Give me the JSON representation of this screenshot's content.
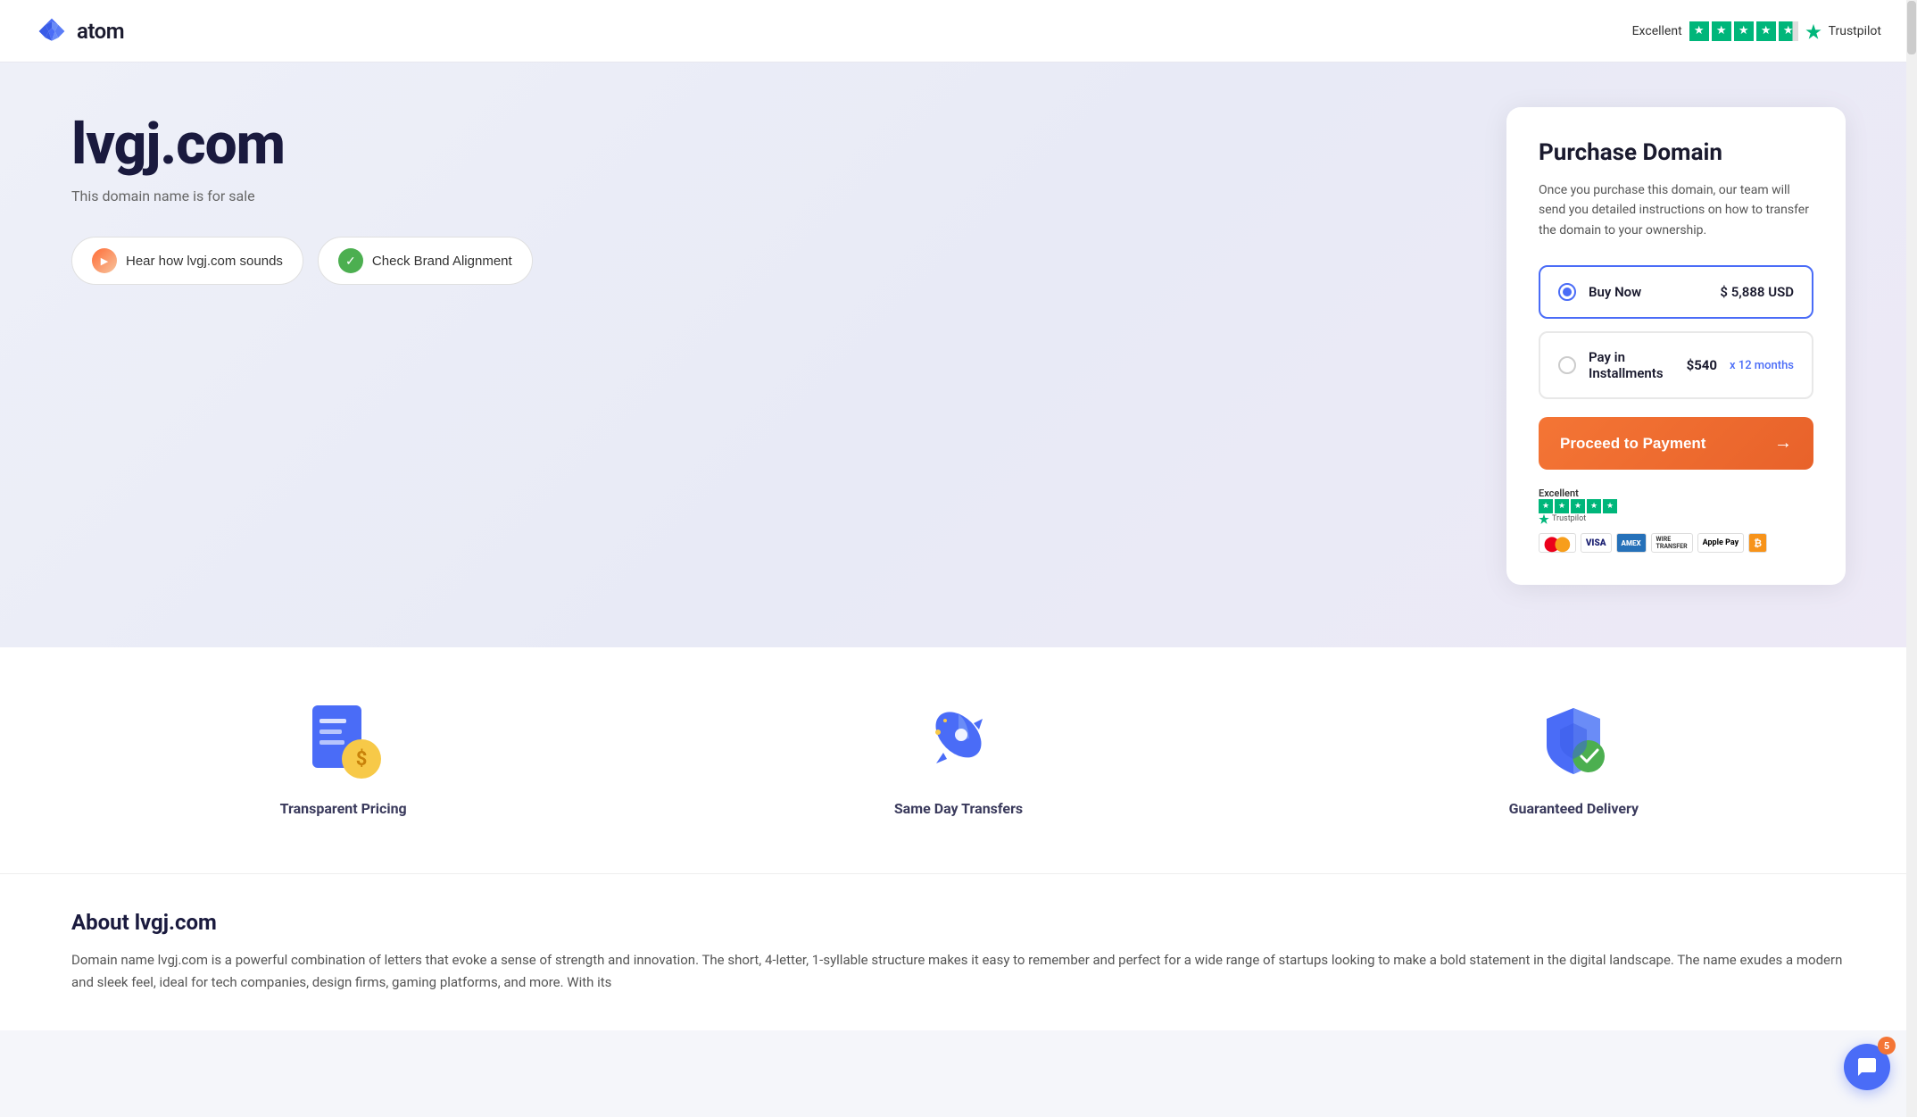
{
  "header": {
    "logo_text": "atom",
    "trustpilot_label": "Excellent",
    "trustpilot_brand": "Trustpilot"
  },
  "hero": {
    "domain": "lvgj.com",
    "subtitle": "This domain name is for sale",
    "btn_hear": "Hear how lvgj.com sounds",
    "btn_brand": "Check Brand Alignment"
  },
  "purchase_card": {
    "title": "Purchase Domain",
    "description": "Once you purchase this domain, our team will send you detailed instructions on how to transfer the domain to your ownership.",
    "buy_now_label": "Buy Now",
    "buy_now_price": "$ 5,888 USD",
    "installments_label": "Pay in Installments",
    "installments_price": "$540",
    "installments_period": "x 12 months",
    "proceed_label": "Proceed to Payment",
    "trustpilot_label": "Excellent",
    "trustpilot_brand": "Trustpilot"
  },
  "features": [
    {
      "id": "transparent-pricing",
      "title": "Transparent Pricing"
    },
    {
      "id": "same-day-transfers",
      "title": "Same Day Transfers"
    },
    {
      "id": "guaranteed-delivery",
      "title": "Guaranteed Delivery"
    }
  ],
  "about": {
    "title": "About lvgj.com",
    "text": "Domain name lvgj.com is a powerful combination of letters that evoke a sense of strength and innovation. The short, 4-letter, 1-syllable structure makes it easy to remember and perfect for a wide range of startups looking to make a bold statement in the digital landscape. The name exudes a modern and sleek feel, ideal for tech companies, design firms, gaming platforms, and more. With its"
  },
  "chat": {
    "badge": "5"
  }
}
